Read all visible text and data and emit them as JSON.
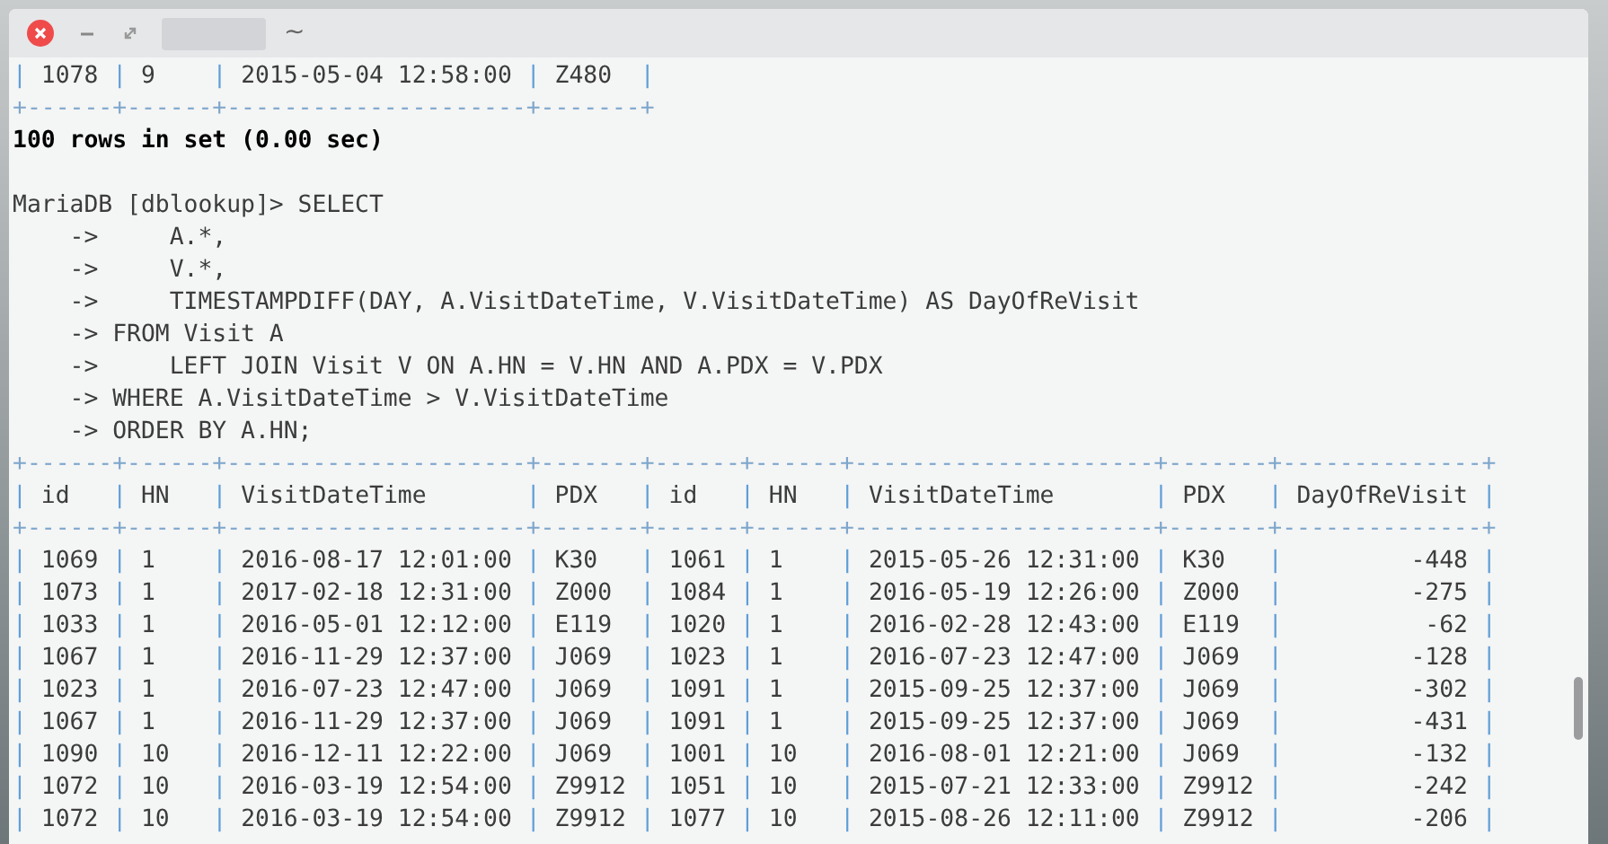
{
  "window": {
    "title": "~"
  },
  "terminal": {
    "separator": "|",
    "lines": [
      {
        "kind": "row",
        "cells": [
          " 1078 ",
          " 9    ",
          " 2015-05-04 12:58:00 ",
          " Z480  "
        ]
      },
      {
        "kind": "border",
        "text": "+------+------+---------------------+-------+"
      },
      {
        "kind": "bold",
        "text": "100 rows in set (0.00 sec)"
      },
      {
        "kind": "blank"
      },
      {
        "kind": "text",
        "text": "MariaDB [dblookup]> SELECT"
      },
      {
        "kind": "text",
        "text": "    ->     A.*,"
      },
      {
        "kind": "text",
        "text": "    ->     V.*,"
      },
      {
        "kind": "text",
        "text": "    ->     TIMESTAMPDIFF(DAY, A.VisitDateTime, V.VisitDateTime) AS DayOfReVisit"
      },
      {
        "kind": "text",
        "text": "    -> FROM Visit A"
      },
      {
        "kind": "text",
        "text": "    ->     LEFT JOIN Visit V ON A.HN = V.HN AND A.PDX = V.PDX"
      },
      {
        "kind": "text",
        "text": "    -> WHERE A.VisitDateTime > V.VisitDateTime"
      },
      {
        "kind": "text",
        "text": "    -> ORDER BY A.HN;"
      },
      {
        "kind": "border",
        "text": "+------+------+---------------------+-------+------+------+---------------------+-------+--------------+"
      },
      {
        "kind": "row",
        "cells": [
          " id   ",
          " HN   ",
          " VisitDateTime       ",
          " PDX   ",
          " id   ",
          " HN   ",
          " VisitDateTime       ",
          " PDX   ",
          " DayOfReVisit "
        ]
      },
      {
        "kind": "border",
        "text": "+------+------+---------------------+-------+------+------+---------------------+-------+--------------+"
      },
      {
        "kind": "row",
        "cells": [
          " 1069 ",
          " 1    ",
          " 2016-08-17 12:01:00 ",
          " K30   ",
          " 1061 ",
          " 1    ",
          " 2015-05-26 12:31:00 ",
          " K30   ",
          "         -448 "
        ]
      },
      {
        "kind": "row",
        "cells": [
          " 1073 ",
          " 1    ",
          " 2017-02-18 12:31:00 ",
          " Z000  ",
          " 1084 ",
          " 1    ",
          " 2016-05-19 12:26:00 ",
          " Z000  ",
          "         -275 "
        ]
      },
      {
        "kind": "row",
        "cells": [
          " 1033 ",
          " 1    ",
          " 2016-05-01 12:12:00 ",
          " E119  ",
          " 1020 ",
          " 1    ",
          " 2016-02-28 12:43:00 ",
          " E119  ",
          "          -62 "
        ]
      },
      {
        "kind": "row",
        "cells": [
          " 1067 ",
          " 1    ",
          " 2016-11-29 12:37:00 ",
          " J069  ",
          " 1023 ",
          " 1    ",
          " 2016-07-23 12:47:00 ",
          " J069  ",
          "         -128 "
        ]
      },
      {
        "kind": "row",
        "cells": [
          " 1023 ",
          " 1    ",
          " 2016-07-23 12:47:00 ",
          " J069  ",
          " 1091 ",
          " 1    ",
          " 2015-09-25 12:37:00 ",
          " J069  ",
          "         -302 "
        ]
      },
      {
        "kind": "row",
        "cells": [
          " 1067 ",
          " 1    ",
          " 2016-11-29 12:37:00 ",
          " J069  ",
          " 1091 ",
          " 1    ",
          " 2015-09-25 12:37:00 ",
          " J069  ",
          "         -431 "
        ]
      },
      {
        "kind": "row",
        "cells": [
          " 1090 ",
          " 10   ",
          " 2016-12-11 12:22:00 ",
          " J069  ",
          " 1001 ",
          " 10   ",
          " 2016-08-01 12:21:00 ",
          " J069  ",
          "         -132 "
        ]
      },
      {
        "kind": "row",
        "cells": [
          " 1072 ",
          " 10   ",
          " 2016-03-19 12:54:00 ",
          " Z9912 ",
          " 1051 ",
          " 10   ",
          " 2015-07-21 12:33:00 ",
          " Z9912 ",
          "         -242 "
        ]
      },
      {
        "kind": "row",
        "cells": [
          " 1072 ",
          " 10   ",
          " 2016-03-19 12:54:00 ",
          " Z9912 ",
          " 1077 ",
          " 10   ",
          " 2015-08-26 12:11:00 ",
          " Z9912 ",
          "         -206 "
        ]
      }
    ]
  }
}
